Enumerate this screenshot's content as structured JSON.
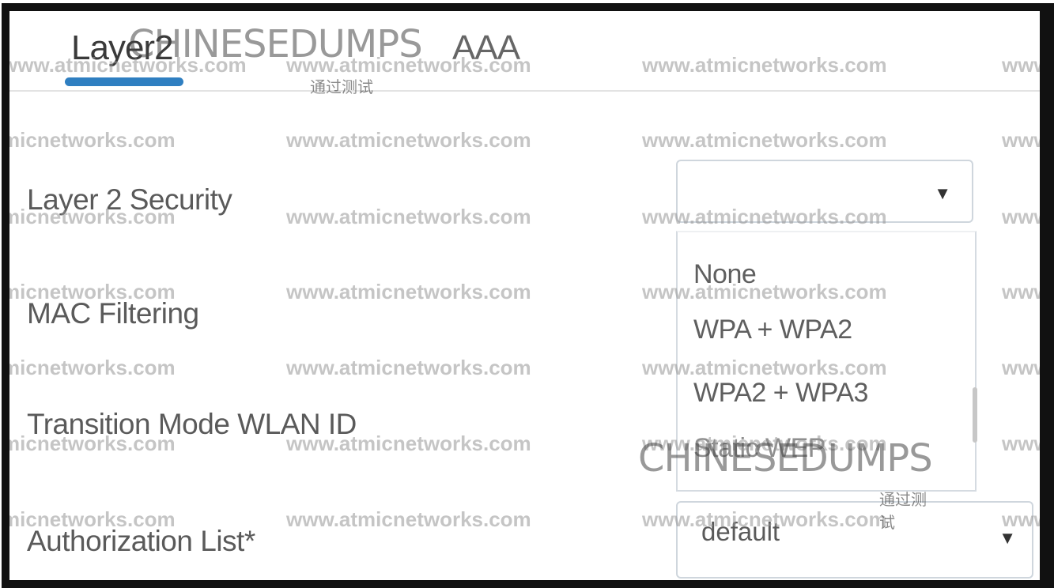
{
  "tabs": [
    {
      "label": "Layer2",
      "active": true
    },
    {
      "label": "AAA",
      "active": false
    }
  ],
  "accent_color": "#2f7fc1",
  "form": {
    "layer2_security_label": "Layer 2 Security",
    "layer2_security_value": "",
    "mac_filtering_label": "MAC Filtering",
    "transition_mode_label": "Transition Mode WLAN ID",
    "authorization_list_label": "Authorization List*",
    "authorization_list_value": "default"
  },
  "dropdown": {
    "options": [
      "None",
      "WPA + WPA2",
      "WPA2 + WPA3",
      "Static WEP"
    ]
  },
  "watermark": {
    "text": "www.atmicnetworks.com",
    "logo": "CHINESEDUMPS",
    "logo_sub": "通过测试"
  }
}
